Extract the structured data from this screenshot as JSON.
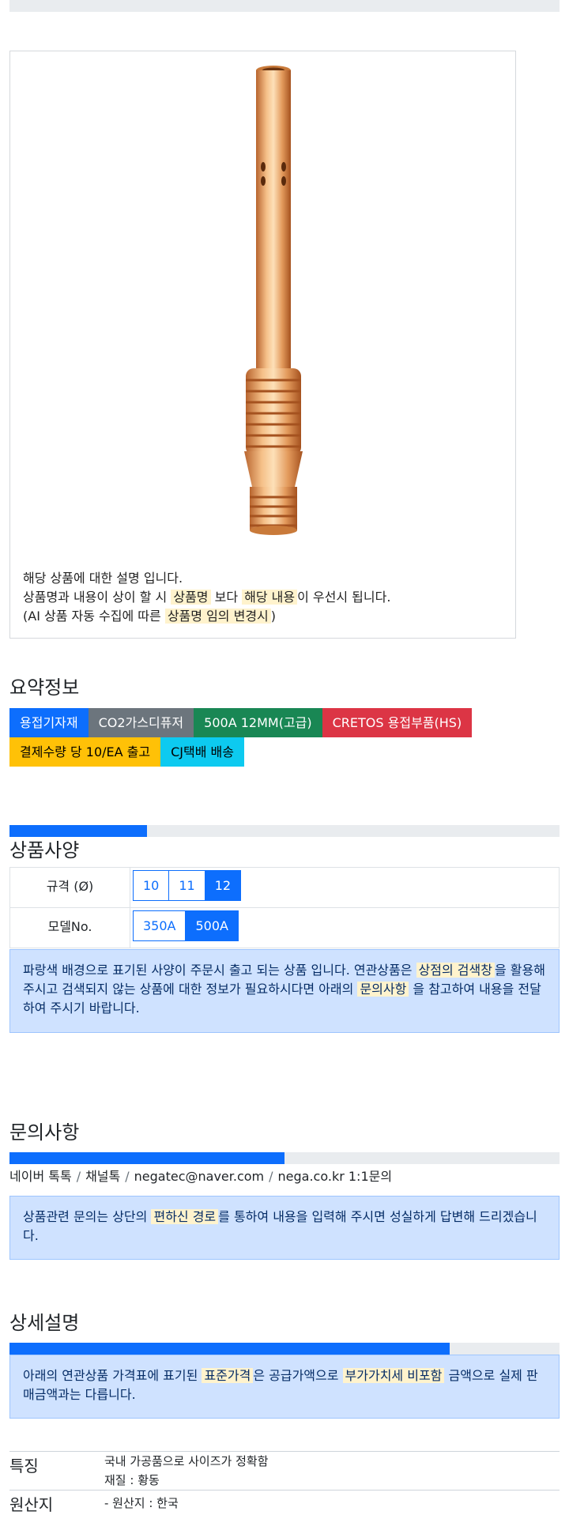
{
  "product_card": {
    "image_alt": "welding contact tip holder",
    "description_line1": "해당 상품에 대한 설명 입니다.",
    "line2_pre": "상품명과 내용이 상이 할 시 ",
    "line2_mark1": "상품명",
    "line2_mid": " 보다 ",
    "line2_mark2": "해당 내용",
    "line2_post": "이 우선시 됩니다.",
    "line3_pre": "(AI 상품 자동 수집에 따른 ",
    "line3_mark": "상품명 임의 변경시",
    "line3_post": ")"
  },
  "summary": {
    "title": "요약정보",
    "badges": [
      {
        "label": "용접기자재",
        "color": "#0d6efd"
      },
      {
        "label": "CO2가스디퓨저",
        "color": "#6c757d"
      },
      {
        "label": "500A 12MM(고급)",
        "color": "#198754"
      },
      {
        "label": "CRETOS 용접부품(HS)",
        "color": "#dc3545"
      },
      {
        "label": "결제수량 당 10/EA 출고",
        "color": "#ffc107"
      },
      {
        "label": "CJ택배 배송",
        "color": "#0dcaf0"
      }
    ]
  },
  "spec": {
    "progress": 0.25,
    "title": "상품사양",
    "rows": [
      {
        "label": "규격 (Ø)",
        "options": [
          "10",
          "11",
          "12"
        ],
        "selected": "12"
      },
      {
        "label": "모델No.",
        "options": [
          "350A",
          "500A"
        ],
        "selected": "500A"
      }
    ],
    "notice_pre": "파랑색 배경으로 표기된 사양이 주문시 출고 되는 상품 입니다. 연관상품은 ",
    "notice_mark1": "상점의 검색창",
    "notice_mid": "을 활용해 주시고 검색되지 않는 상품에 대한 정보가 필요하시다면 아래의 ",
    "notice_mark2": "문의사항",
    "notice_post": " 을 참고하여 내용을 전달하여 주시기 바랍니다."
  },
  "inquiry": {
    "title": "문의사항",
    "progress": 0.5,
    "contacts": [
      "네이버 톡톡",
      "채널톡",
      "negatec@naver.com",
      "nega.co.kr 1:1문의"
    ],
    "separator": "/",
    "notice_pre": "상품관련 문의는 상단의 ",
    "notice_mark": "편하신 경로",
    "notice_post": "를 통하여 내용을 입력해 주시면 성실하게 답변해 드리겠습니다."
  },
  "details": {
    "title": "상세설명",
    "progress": 0.8,
    "notice_pre": "아래의 연관상품 가격표에 표기된 ",
    "notice_mark1": "표준가격",
    "notice_mid": "은 공급가액으로 ",
    "notice_mark2": "부가가치세 비포함",
    "notice_post": " 금액으로 실제 판매금액과는 다릅니다.",
    "rows": [
      {
        "label": "특징",
        "lines": [
          "국내 가공품으로 사이즈가 정확함",
          "재질 : 황동"
        ]
      },
      {
        "label": "원산지",
        "lines": [
          "- 원산지 : 한국"
        ]
      }
    ]
  }
}
